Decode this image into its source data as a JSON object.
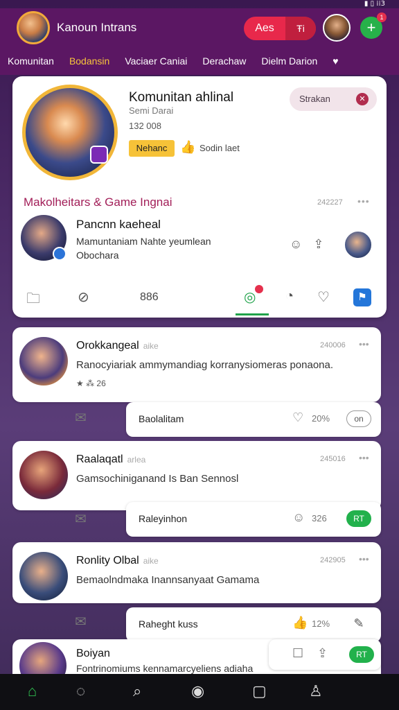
{
  "status_icons": "▮ ▯ ⁞⁞3",
  "header": {
    "title": "Kanoun Intrans",
    "pill_a": "Aes",
    "pill_b": "Ŧi",
    "plus": "+",
    "badge": "1"
  },
  "tabs": [
    {
      "label": "Komunitan"
    },
    {
      "label": "Bodansin",
      "active": true
    },
    {
      "label": "Vaciaer Caniai"
    },
    {
      "label": "Derachaw"
    },
    {
      "label": "Dielm Darion"
    },
    {
      "label": "♥"
    }
  ],
  "hero": {
    "name": "Komunitan ahlinal",
    "subtitle": "Semi Darai",
    "count": "132 008",
    "follow_label": "Nehanc",
    "sub2": "Sodin laet",
    "pill_label": "Strakan"
  },
  "section": {
    "title": "Makolheitars & Game  Ingnai",
    "date": "242227",
    "more": "•••"
  },
  "post1": {
    "name": "Pancnn kaeheal",
    "text": "Mamuntaniam Nahte yeumlean Obochara"
  },
  "actionbar": {
    "count": "886"
  },
  "feed": [
    {
      "name": "Orokkangeal",
      "tag": "aike",
      "date": "240006",
      "more": "•••",
      "text": "Ranocyiariak ammymandiag korranysiomeras ponaona.",
      "meta": "★ ⁂ 26",
      "reply": {
        "label": "Baolalitam",
        "pct": "20%",
        "btn": "on"
      }
    },
    {
      "name": "Raalaqatl",
      "tag": "arlea",
      "date": "245016",
      "more": "•••",
      "text": "Gamsochiniganand Is Ban Sennosl",
      "reply": {
        "label": "Raleyinhon",
        "pct": "326",
        "btn": "RT"
      }
    },
    {
      "name": "Ronlity Olbal",
      "tag": "aike",
      "date": "242905",
      "more": "•••",
      "text": "Bemaolndmaka Inannsanyaat Gamama",
      "reply": {
        "label": "Raheght kuss",
        "pct": "12%",
        "btn": ""
      }
    },
    {
      "name": "Boiyan",
      "tag": "",
      "date": "",
      "more": "",
      "text": "Fontrinomiums kennamarcyeliens adiaha",
      "reply": {
        "label": "",
        "pct": "",
        "btn": "RT"
      }
    }
  ]
}
